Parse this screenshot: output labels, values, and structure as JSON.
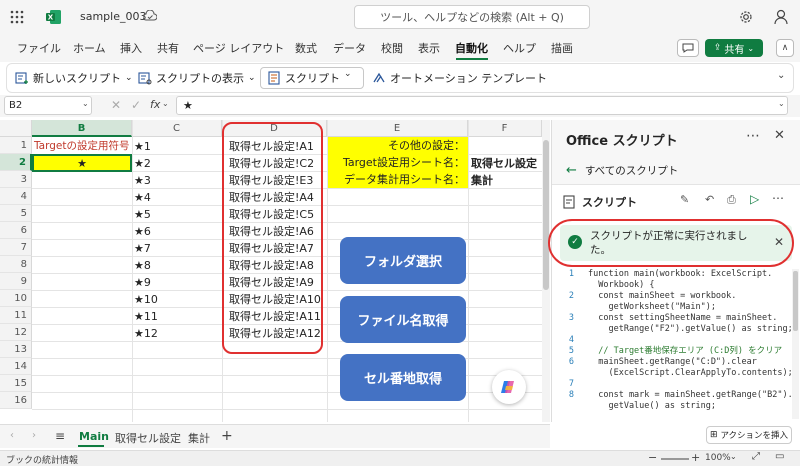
{
  "titlebar": {
    "filename": "sample_003",
    "search_placeholder": "ツール、ヘルプなどの検索 (Alt + Q)"
  },
  "menubar": {
    "items": [
      "ファイル",
      "ホーム",
      "挿入",
      "共有",
      "ページ レイアウト",
      "数式",
      "データ",
      "校閲",
      "表示",
      "自動化",
      "ヘルプ",
      "描画"
    ],
    "active": "自動化",
    "share_label": "共有"
  },
  "ribbon": {
    "new_script": "新しいスクリプト",
    "show_scripts": "スクリプトの表示",
    "script": "スクリプト",
    "automation_template": "オートメーション テンプレート"
  },
  "formulabar": {
    "namebox": "B2",
    "fx": "fx",
    "content": "★"
  },
  "grid": {
    "columns": [
      "B",
      "C",
      "D",
      "E",
      "F"
    ],
    "rows": [
      "1",
      "2",
      "3",
      "4",
      "5",
      "6",
      "7",
      "8",
      "9",
      "10",
      "11",
      "12",
      "13",
      "14",
      "15",
      "16"
    ],
    "b1": "Targetの設定用符号",
    "b2": "★",
    "c_values": [
      "★1",
      "★2",
      "★3",
      "★4",
      "★5",
      "★6",
      "★7",
      "★8",
      "★9",
      "★10",
      "★11",
      "★12"
    ],
    "d_values": [
      "取得セル設定!A1",
      "取得セル設定!C2",
      "取得セル設定!E3",
      "取得セル設定!A4",
      "取得セル設定!C5",
      "取得セル設定!A6",
      "取得セル設定!A7",
      "取得セル設定!A8",
      "取得セル設定!A9",
      "取得セル設定!A10",
      "取得セル設定!A11",
      "取得セル設定!A12"
    ],
    "e1": "その他の設定：",
    "e2": "Target設定用シート名：",
    "e3": "データ集計用シート名：",
    "f2": "取得セル設定",
    "f3": "集計",
    "buttons": [
      "フォルダ選択",
      "ファイル名取得",
      "セル番地取得"
    ]
  },
  "pane": {
    "title": "Office スクリプト",
    "back_label": "すべてのスクリプト",
    "script_label": "スクリプト",
    "success_message": "スクリプトが正常に実行されました。",
    "code_lines": [
      {
        "n": "1",
        "t": "function main(workbook: ExcelScript."
      },
      {
        "n": "",
        "t": "  Workbook) {"
      },
      {
        "n": "2",
        "t": "  const mainSheet = workbook."
      },
      {
        "n": "",
        "t": "    getWorksheet(\"Main\");"
      },
      {
        "n": "3",
        "t": "  const settingSheetName = mainSheet."
      },
      {
        "n": "",
        "t": "    getRange(\"F2\").getValue() as string;"
      },
      {
        "n": "4",
        "t": ""
      },
      {
        "n": "5",
        "t": "  // Target番地保存エリア (C:D列) をクリア"
      },
      {
        "n": "6",
        "t": "  mainSheet.getRange(\"C:D\").clear"
      },
      {
        "n": "",
        "t": "    (ExcelScript.ClearApplyTo.contents);"
      },
      {
        "n": "7",
        "t": ""
      },
      {
        "n": "8",
        "t": "  const mark = mainSheet.getRange(\"B2\")."
      },
      {
        "n": "",
        "t": "    getValue() as string;"
      }
    ],
    "action_button": "アクションを挿入"
  },
  "sheettabs": {
    "tabs": [
      "Main",
      "取得セル設定",
      "集計"
    ],
    "active": "Main"
  },
  "statusbar": {
    "left": "ブックの統計情報",
    "zoom": "100%"
  },
  "colors": {
    "accent_green": "#107c41",
    "macro_button": "#4472c4",
    "yellow_fill": "#ffff00",
    "annotation_red": "#e03030",
    "success_bg": "#e6f4ea"
  }
}
